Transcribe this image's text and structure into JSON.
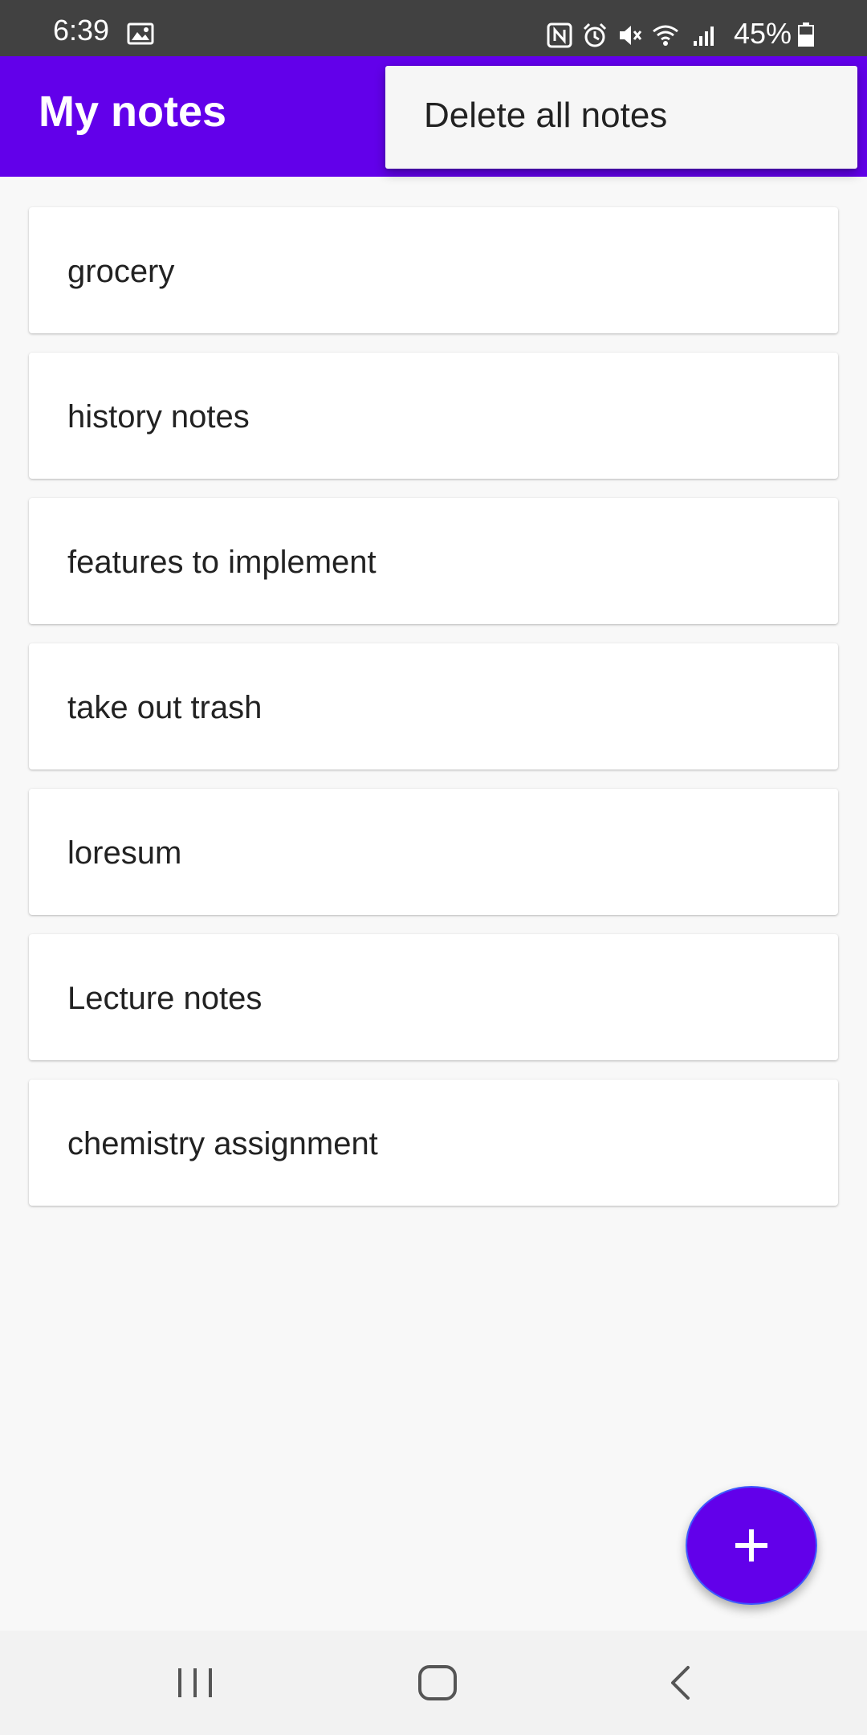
{
  "status_bar": {
    "time": "6:39",
    "battery": "45%",
    "icons": [
      "gallery-icon",
      "nfc-icon",
      "alarm-icon",
      "mute-icon",
      "wifi-icon",
      "signal-icon",
      "battery-icon"
    ]
  },
  "app_bar": {
    "title": "My notes",
    "color": "#6200ea"
  },
  "overflow_menu": {
    "items": [
      {
        "label": "Delete all notes"
      }
    ]
  },
  "notes": [
    {
      "title": "grocery"
    },
    {
      "title": "history notes"
    },
    {
      "title": "features to implement"
    },
    {
      "title": "take out trash"
    },
    {
      "title": "loresum"
    },
    {
      "title": "Lecture notes"
    },
    {
      "title": "chemistry assignment"
    }
  ],
  "fab": {
    "icon": "plus-icon",
    "color": "#6200ea"
  },
  "nav_bar": {
    "buttons": [
      "recents-icon",
      "home-icon",
      "back-icon"
    ]
  }
}
